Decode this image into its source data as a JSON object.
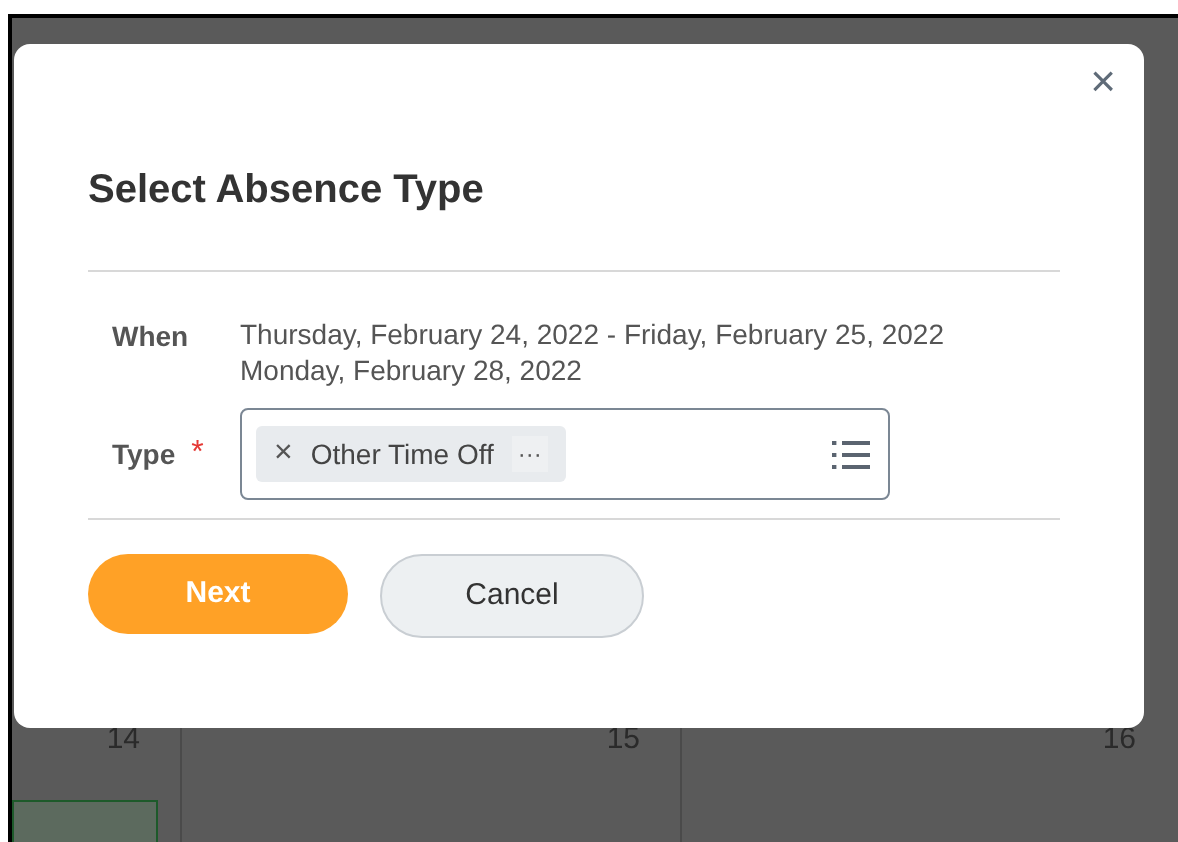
{
  "calendar": {
    "days": [
      {
        "label": "14"
      },
      {
        "label": "15"
      },
      {
        "label": "16"
      }
    ]
  },
  "dialog": {
    "title": "Select Absence Type",
    "close": "×",
    "fields": [
      {
        "kind": "text",
        "label": "When",
        "lines": [
          "Thursday, February 24, 2022 - Friday, February 25, 2022",
          "Monday, February 28, 2022"
        ]
      },
      {
        "kind": "picker",
        "label": "Type",
        "required": true,
        "required_mark": "*",
        "tokens": [
          {
            "remove": "×",
            "label": "Other Time Off",
            "more": "···"
          }
        ]
      }
    ],
    "buttons": [
      {
        "label": "Next",
        "kind": "primary"
      },
      {
        "label": "Cancel",
        "kind": "secondary"
      }
    ]
  }
}
